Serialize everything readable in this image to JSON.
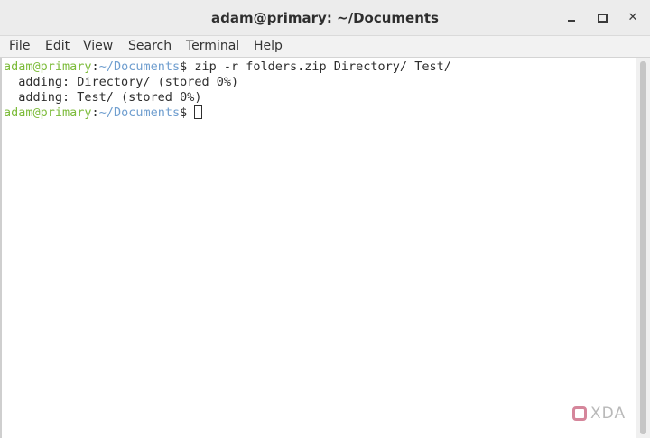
{
  "window": {
    "title": "adam@primary: ~/Documents",
    "minimize_icon": "minimize-icon",
    "maximize_icon": "maximize-icon",
    "close_glyph": "✕"
  },
  "menu": {
    "items": [
      "File",
      "Edit",
      "View",
      "Search",
      "Terminal",
      "Help"
    ]
  },
  "terminal": {
    "prompt_user": "adam@primary",
    "prompt_colon": ":",
    "prompt_path": "~/Documents",
    "prompt_symbol": "$ ",
    "command": "zip -r folders.zip Directory/ Test/",
    "output": [
      "  adding: Directory/ (stored 0%)",
      "  adding: Test/ (stored 0%)"
    ],
    "colors": {
      "user": "#7cbb3a",
      "path": "#6f9ecf",
      "text": "#2e2e2e"
    }
  },
  "watermark": {
    "text": "XDA",
    "logo": "xda-logo-icon"
  }
}
